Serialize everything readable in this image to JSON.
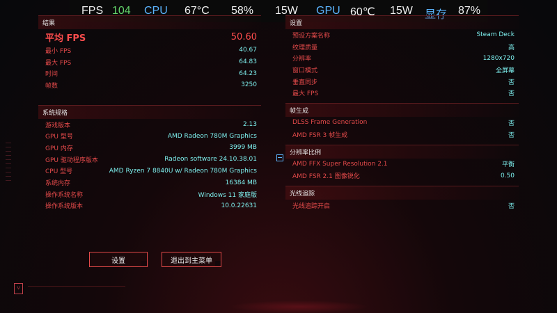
{
  "overlay": {
    "fps_label": "FPS",
    "fps_value": "104",
    "cpu_label": "CPU",
    "cpu_temp": "67°C",
    "cpu_usage": "58%",
    "cpu_power": "15W",
    "gpu_label": "GPU",
    "gpu_temp": "60℃",
    "gpu_power": "15W",
    "vram_label": "显存",
    "vram_usage": "87%",
    "colors": {
      "fps_value": "#63d46a",
      "labels_blue": "#5cb5ff"
    }
  },
  "results": {
    "title": "结果",
    "avg_fps": {
      "label": "平均 FPS",
      "value": "50.60"
    },
    "rows": [
      {
        "label": "最小 FPS",
        "value": "40.67"
      },
      {
        "label": "最大 FPS",
        "value": "64.83"
      },
      {
        "label": "时间",
        "value": "64.23"
      },
      {
        "label": "帧数",
        "value": "3250"
      }
    ]
  },
  "specs": {
    "title": "系统规格",
    "rows": [
      {
        "label": "游戏版本",
        "value": "2.13"
      },
      {
        "label": "GPU 型号",
        "value": "AMD Radeon 780M Graphics"
      },
      {
        "label": "GPU 内存",
        "value": "3999 MB"
      },
      {
        "label": "GPU 驱动程序版本",
        "value": "Radeon software 24.10.38.01"
      },
      {
        "label": "CPU 型号",
        "value": "AMD Ryzen 7 8840U w/ Radeon 780M Graphics"
      },
      {
        "label": "系统内存",
        "value": "16384 MB"
      },
      {
        "label": "操作系统名称",
        "value": "Windows 11 家庭版"
      },
      {
        "label": "操作系统版本",
        "value": "10.0.22631"
      }
    ]
  },
  "settings": {
    "title": "设置",
    "rows": [
      {
        "label": "预设方案名称",
        "value": "Steam Deck"
      },
      {
        "label": "纹理质量",
        "value": "高"
      },
      {
        "label": "分辨率",
        "value": "1280x720"
      },
      {
        "label": "窗口模式",
        "value": "全屏幕"
      },
      {
        "label": "垂直同步",
        "value": "否"
      },
      {
        "label": "最大 FPS",
        "value": "否"
      }
    ]
  },
  "frame_gen": {
    "title": "帧生成",
    "rows": [
      {
        "label": "DLSS Frame Generation",
        "value": "否"
      },
      {
        "label": "AMD FSR 3 帧生成",
        "value": "否"
      }
    ]
  },
  "resolution_scaling": {
    "title": "分辨率比例",
    "rows": [
      {
        "label": "AMD FFX Super Resolution 2.1",
        "value": "平衡"
      },
      {
        "label": "AMD FSR 2.1 图像锐化",
        "value": "0.50"
      }
    ]
  },
  "ray_tracing": {
    "title": "光线追踪",
    "rows": [
      {
        "label": "光线追踪开启",
        "value": "否"
      }
    ]
  },
  "buttons": {
    "settings": "设置",
    "exit": "退出到主菜单"
  },
  "logo_text": "V"
}
